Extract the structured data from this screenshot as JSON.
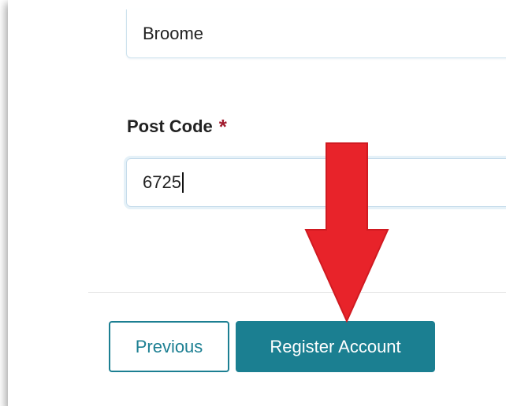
{
  "form": {
    "city_value": "Broome",
    "postcode_label": "Post Code",
    "required_marker": "*",
    "postcode_value": "6725"
  },
  "actions": {
    "previous_label": "Previous",
    "register_label": "Register Account"
  },
  "annotation": {
    "arrow_color": "#e8232a",
    "arrow_direction": "down",
    "arrow_icon": "down-arrow-icon"
  },
  "colors": {
    "primary": "#1b7f91",
    "required": "#a11b2e"
  }
}
